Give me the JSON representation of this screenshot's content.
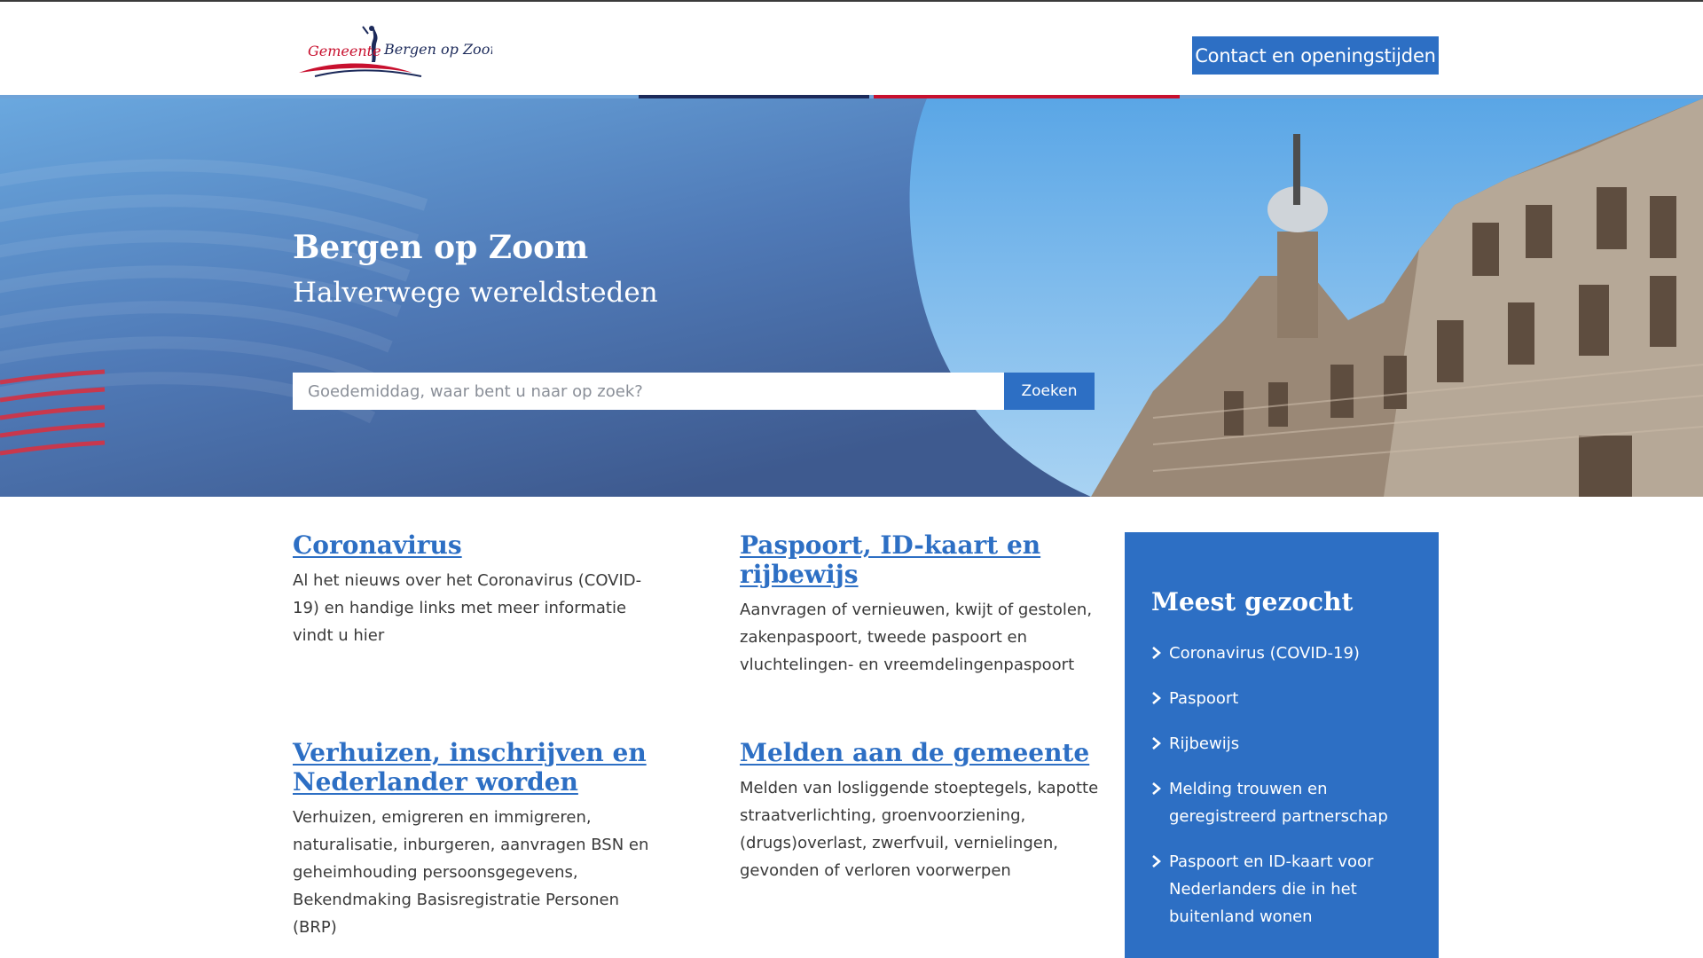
{
  "header": {
    "logo_text_gemeente": "Gemeente",
    "logo_text_city": "Bergen op Zoom",
    "contact_label": "Contact en openingstijden"
  },
  "hero": {
    "title": "Bergen op Zoom",
    "subtitle": "Halverwege wereldsteden",
    "search_placeholder": "Goedemiddag, waar bent u naar op zoek?",
    "search_button": "Zoeken"
  },
  "cards": [
    {
      "title": "Coronavirus",
      "description": "Al het nieuws over het Coronavirus (COVID-19) en handige links met meer informatie vindt u hier"
    },
    {
      "title": "Paspoort, ID-kaart en rijbewijs",
      "description": "Aanvragen of vernieuwen, kwijt of gestolen, zakenpaspoort, tweede paspoort en vluchtelingen- en vreemdelingenpaspoort"
    },
    {
      "title": "Verhuizen, inschrijven en Nederlander worden",
      "description": "Verhuizen, emigreren en immigreren, naturalisatie, inburgeren, aanvragen BSN en geheimhouding persoonsgegevens, Bekendmaking Basisregistratie Personen (BRP)"
    },
    {
      "title": "Melden aan de gemeente",
      "description": "Melden van losliggende stoeptegels, kapotte straatverlichting, groenvoorziening, (drugs)overlast, zwerfvuil, vernielingen, gevonden of verloren voorwerpen"
    }
  ],
  "popular": {
    "title": "Meest gezocht",
    "items": [
      "Coronavirus (COVID-19)",
      "Paspoort",
      "Rijbewijs",
      "Melding trouwen en geregistreerd partnerschap",
      "Paspoort en ID-kaart voor Nederlanders die in het buitenland wonen"
    ]
  },
  "colors": {
    "accent_blue": "#2d6fc4",
    "brand_red": "#c8102e",
    "brand_navy": "#1c2a5a"
  }
}
